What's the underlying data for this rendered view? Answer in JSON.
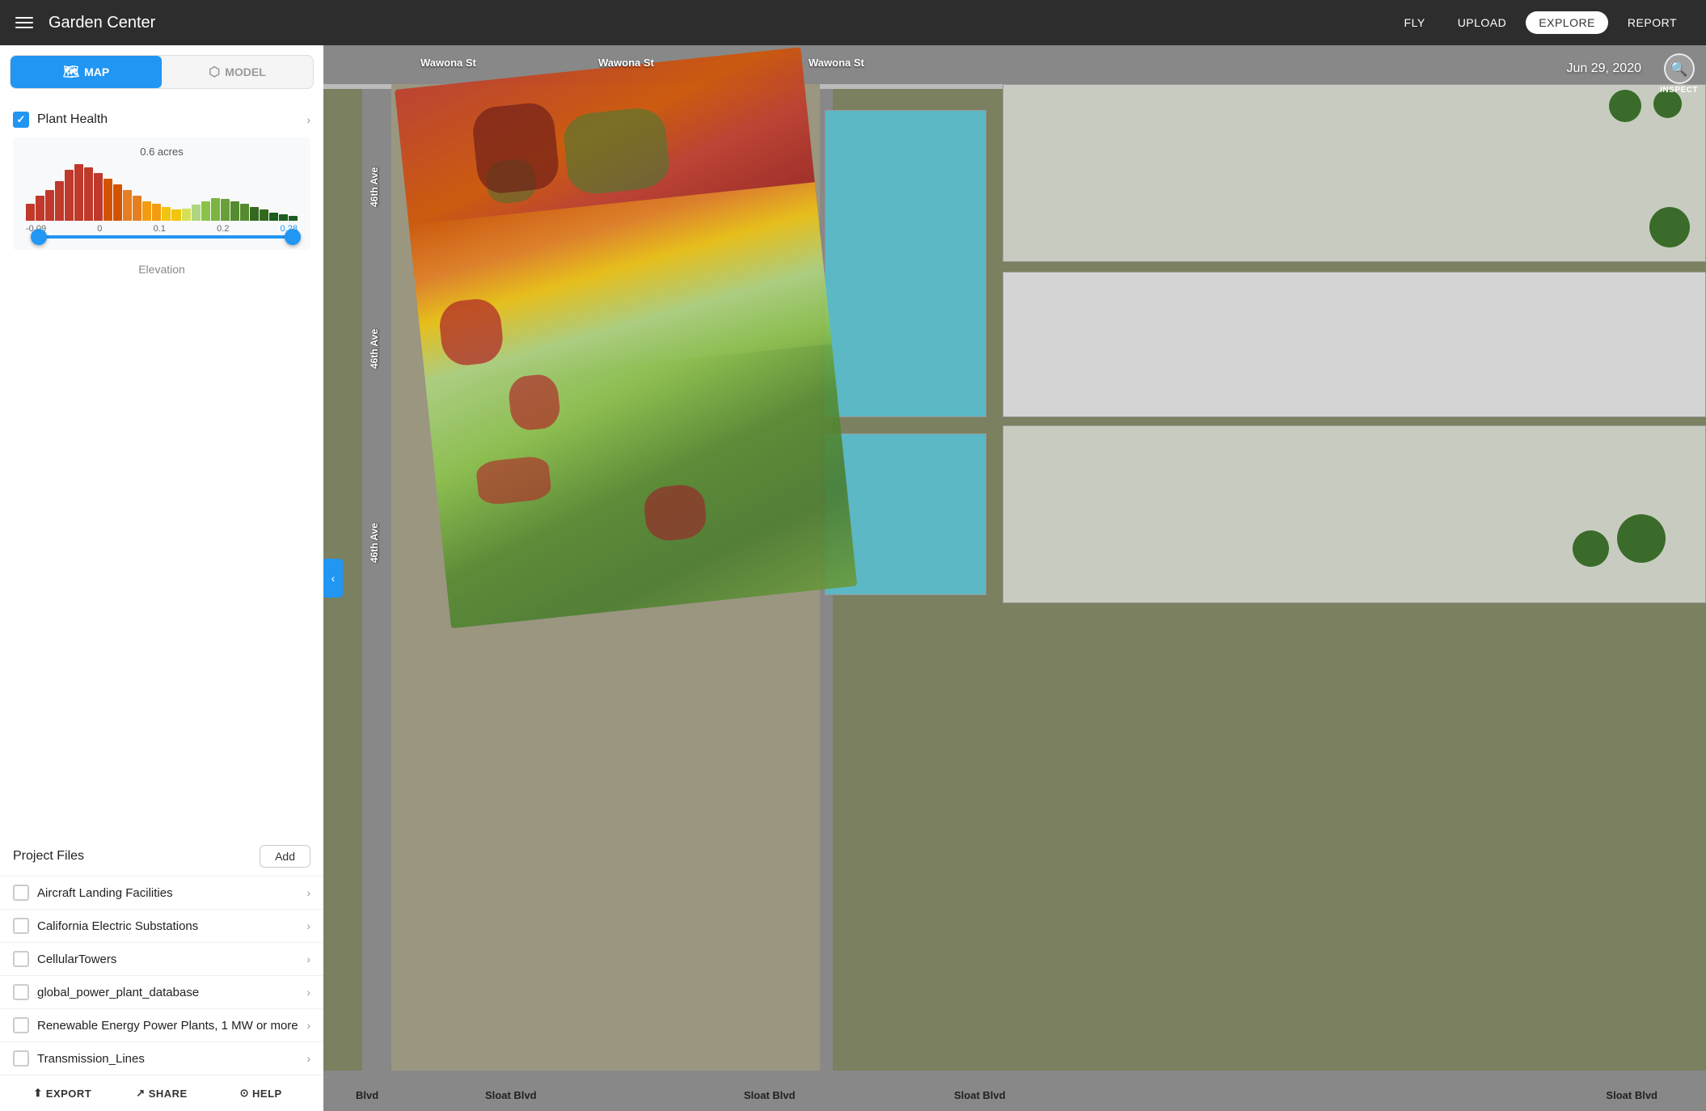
{
  "header": {
    "menu_icon": "hamburger",
    "title": "Garden Center",
    "nav_items": [
      {
        "id": "fly",
        "label": "FLY",
        "active": false
      },
      {
        "id": "upload",
        "label": "UPLOAD",
        "active": false
      },
      {
        "id": "explore",
        "label": "EXPLORE",
        "active": true
      },
      {
        "id": "report",
        "label": "REPORT",
        "active": false
      }
    ]
  },
  "sidebar": {
    "view_toggle": {
      "map_label": "MAP",
      "map_active": true,
      "model_label": "MODEL"
    },
    "plant_health": {
      "label": "Plant Health",
      "checked": true,
      "acres": "0.6 acres",
      "axis_min": "-0.09",
      "axis_zero": "0",
      "axis_01": "0.1",
      "axis_02": "0.2",
      "axis_max": "0.28"
    },
    "elevation_label": "Elevation",
    "project_files": {
      "title": "Project Files",
      "add_label": "Add",
      "items": [
        {
          "id": "aircraft",
          "label": "Aircraft Landing Facilities",
          "checked": false
        },
        {
          "id": "california",
          "label": "California Electric Substations",
          "checked": false
        },
        {
          "id": "cellular",
          "label": "CellularTowers",
          "checked": false
        },
        {
          "id": "global-power",
          "label": "global_power_plant_database",
          "checked": false
        },
        {
          "id": "renewable",
          "label": "Renewable Energy Power Plants, 1 MW or more",
          "checked": false
        },
        {
          "id": "transmission",
          "label": "Transmission_Lines",
          "checked": false
        }
      ]
    },
    "footer": {
      "export_label": "EXPORT",
      "share_label": "SHARE",
      "help_label": "HELP"
    }
  },
  "map": {
    "date": "Jun 29, 2020",
    "inspect_label": "INSPECT",
    "street_labels": {
      "wawona_top_left": "Wawona St",
      "wawona_top_center": "Wawona St",
      "wawona_top_right": "Wawona St",
      "ave_46_top": "46th Ave",
      "ave_46_mid": "46th Ave",
      "ave_46_bottom": "46th Ave",
      "sloat_left": "Sloat Blvd",
      "sloat_center": "Sloat Blvd",
      "sloat_right": "Sloat Blvd",
      "sloat_far_right": "Sloat Blvd",
      "blvd_bottom_left": "Blvd"
    }
  }
}
